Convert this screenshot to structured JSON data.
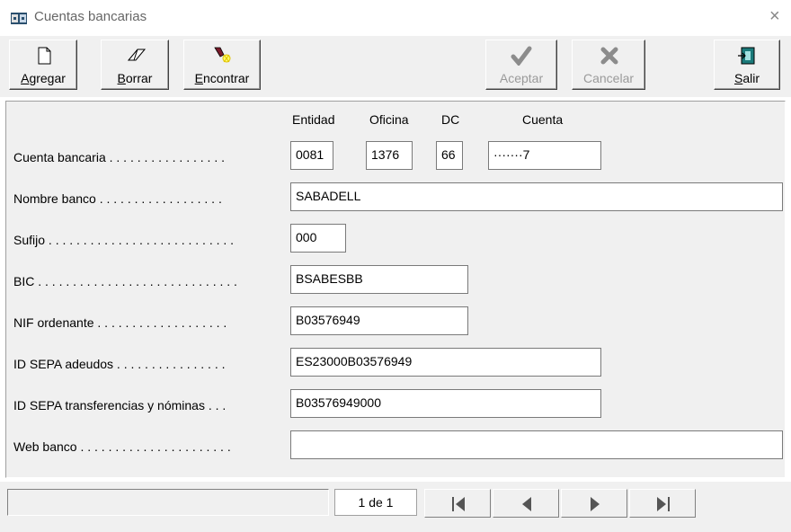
{
  "window": {
    "title": "Cuentas bancarias",
    "close_glyph": "×"
  },
  "toolbar": {
    "agregar": {
      "mnemonic": "A",
      "rest": "gregar",
      "icon": "new-document-icon"
    },
    "borrar": {
      "mnemonic": "B",
      "rest": "orrar",
      "icon": "eraser-icon"
    },
    "encontrar": {
      "mnemonic": "E",
      "rest": "ncontrar",
      "icon": "flashlight-icon"
    },
    "aceptar": {
      "label": "Aceptar",
      "icon": "checkmark-icon",
      "enabled": false
    },
    "cancelar": {
      "label": "Cancelar",
      "icon": "cross-icon",
      "enabled": false
    },
    "salir": {
      "mnemonic": "S",
      "rest": "alir",
      "icon": "exit-door-icon"
    }
  },
  "form": {
    "headers": {
      "entidad": "Entidad",
      "oficina": "Oficina",
      "dc": "DC",
      "cuenta": "Cuenta"
    },
    "cuenta_bancaria": {
      "label": "Cuenta bancaria . . . . . . . . . . . . . . . . .",
      "entidad": "0081",
      "oficina": "1376",
      "dc": "66",
      "cuenta": "·······7"
    },
    "nombre_banco": {
      "label": "Nombre banco . . . . . . . . . . . . . . . . . .",
      "value": "SABADELL"
    },
    "sufijo": {
      "label": "Sufijo . . . . . . . . . . . . . . . . . . . . . . . . . . .",
      "value": "000"
    },
    "bic": {
      "label": "BIC . . . . . . . . . . . . . . . . . . . . . . . . . . . . .",
      "value": "BSABESBB"
    },
    "nif_ordenante": {
      "label": "NIF ordenante . . . . . . . . . . . . . . . . . . .",
      "value": "B03576949"
    },
    "id_sepa_adeudos": {
      "label": "ID SEPA adeudos . . . . . . . . . . . . . . . .",
      "value": "ES23000B03576949"
    },
    "id_sepa_transferencias": {
      "label": "ID SEPA transferencias y nóminas . . .",
      "value": "B03576949000"
    },
    "web_banco": {
      "label": "Web banco . . . . . . . . . . . . . . . . . . . . . .",
      "value": ""
    }
  },
  "statusbar": {
    "page_indicator": "1 de 1",
    "nav": [
      "first-record-icon",
      "previous-record-icon",
      "next-record-icon",
      "last-record-icon"
    ]
  },
  "colors": {
    "chrome": "#f0f0f0",
    "field_bg": "#ffffff",
    "disabled_text": "#9a9a9a"
  }
}
